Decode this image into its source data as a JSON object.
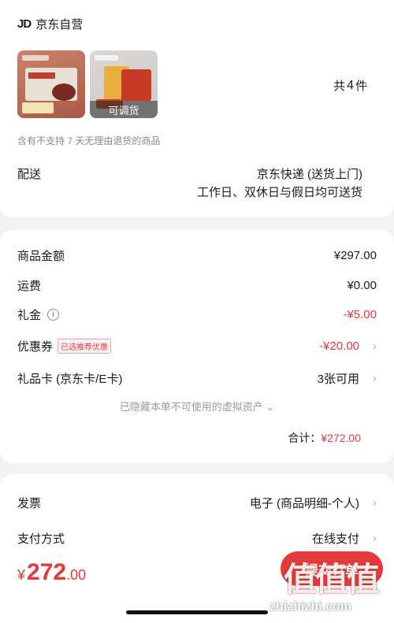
{
  "shop": {
    "logo": "JD",
    "name": "京东自营"
  },
  "products": {
    "thumb1_label": "",
    "thumb2_label": "可调货",
    "count_prefix": "共",
    "count": "4",
    "count_suffix": "件",
    "notice": "含有不支持 7 天无理由退货的商品"
  },
  "delivery": {
    "label": "配送",
    "method": "京东快递 (送货上门)",
    "days": "工作日、双休日与假日均可送货"
  },
  "summary": {
    "goods_label": "商品金额",
    "goods_value": "¥297.00",
    "shipping_label": "运费",
    "shipping_value": "¥0.00",
    "gift_label": "礼金",
    "gift_value": "-¥5.00",
    "coupon_label": "优惠券",
    "coupon_badge": "已选推荐优惠",
    "coupon_value": "-¥20.00",
    "giftcard_label": "礼品卡 (京东卡/E卡)",
    "giftcard_value": "3张可用",
    "hidden_assets": "已隐藏本单不可使用的虚拟资产",
    "total_label": "合计：",
    "total_value": "¥272.00"
  },
  "invoice": {
    "label": "发票",
    "value": "电子 (商品明细-个人)"
  },
  "payment": {
    "label": "支付方式",
    "value": "在线支付"
  },
  "footer": {
    "currency": "¥",
    "price_int": "272",
    "price_dec": ".00",
    "submit_label": "提交订单",
    "watermark": "值值值",
    "watermark_url": "zhizhizhi.com"
  },
  "colors": {
    "accent": "#e4393c",
    "background": "#f2f2f2"
  }
}
